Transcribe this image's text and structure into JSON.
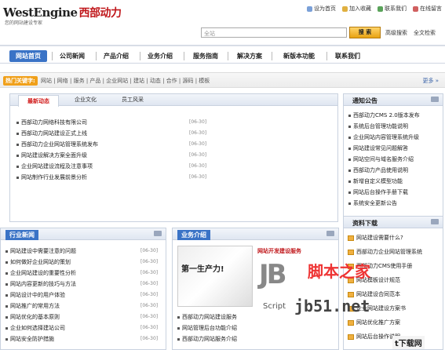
{
  "brand": {
    "logo": "WestEngine",
    "logo_cn": "西部动力",
    "tagline": "您的网站建设专家"
  },
  "toplinks": [
    "设为首页",
    "加入收藏",
    "联系我们",
    "在线留言"
  ],
  "search": {
    "placeholder": "全站",
    "button": "搜 索",
    "links": [
      "高级搜索",
      "全文检索"
    ]
  },
  "nav": [
    "网站首页",
    "公司新闻",
    "产品介绍",
    "业务介绍",
    "服务指南",
    "解决方案",
    "新版本功能",
    "联系我们"
  ],
  "hot": {
    "label": "热门关键字:",
    "links": "网站 | 网络 | 服务 | 产品 | 企业网站 | 建站 | 动态 | 合作 | 源码 | 模板",
    "more": "更多 »"
  },
  "news": {
    "tabs": [
      "最新动态",
      "企业文化",
      "员工风采"
    ],
    "items": [
      {
        "t": "西部动力网络科技有限公司",
        "d": "[06-30]"
      },
      {
        "t": "西部动力网站建设正式上线",
        "d": "[06-30]"
      },
      {
        "t": "西部动力企业网站管理系统发布",
        "d": "[06-30]"
      },
      {
        "t": "网站建设解决方案全面升级",
        "d": "[06-30]"
      },
      {
        "t": "企业网站建设流程及注意事项",
        "d": "[06-30]"
      },
      {
        "t": "网站制作行业发展前景分析",
        "d": "[06-30]"
      }
    ]
  },
  "notice": {
    "title": "通知公告",
    "items": [
      "西部动力CMS 2.0版本发布",
      "系统后台管理功能说明",
      "企业网站内容管理系统升级",
      "网站建设常见问题解答",
      "网站空间与域名服务介绍",
      "西部动力产品使用说明",
      "新增自定义模型功能",
      "网站后台操作手册下载",
      "系统安全更新公告"
    ]
  },
  "download": {
    "title": "资料下载",
    "items": [
      "网站建设需要什么?",
      "西部动力企业网站管理系统",
      "西部动力CMS使用手册",
      "网站模板设计规范",
      "网站建设合同范本",
      "企业网站建设方案书",
      "网站优化推广方案",
      "网站后台操作说明"
    ]
  },
  "tech": {
    "title": "行业新闻",
    "items": [
      {
        "t": "网站建设中需要注意的问题",
        "d": "[06-30]"
      },
      {
        "t": "如何做好企业网站的策划",
        "d": "[06-30]"
      },
      {
        "t": "企业网站建设的重要性分析",
        "d": "[06-30]"
      },
      {
        "t": "网站内容更新的技巧与方法",
        "d": "[06-30]"
      },
      {
        "t": "网站设计中的用户体验",
        "d": "[06-30]"
      },
      {
        "t": "网站推广的常用方法",
        "d": "[06-30]"
      },
      {
        "t": "网站优化的基本原则",
        "d": "[06-30]"
      },
      {
        "t": "企业如何选择建站公司",
        "d": "[06-30]"
      },
      {
        "t": "网站安全防护措施",
        "d": "[06-30]"
      }
    ]
  },
  "service": {
    "title": "业务介绍",
    "banner": "第一生产力!",
    "headline": "网站开发建设服务",
    "items": [
      "西部动力网站建设服务",
      "网站管理后台功能介绍",
      "西部动力网站服务介绍"
    ]
  },
  "watermark": {
    "jb": "JB",
    "script": "Script",
    "cn": "脚本之家",
    "url": "jb51.net",
    "corner": "t下载网"
  }
}
